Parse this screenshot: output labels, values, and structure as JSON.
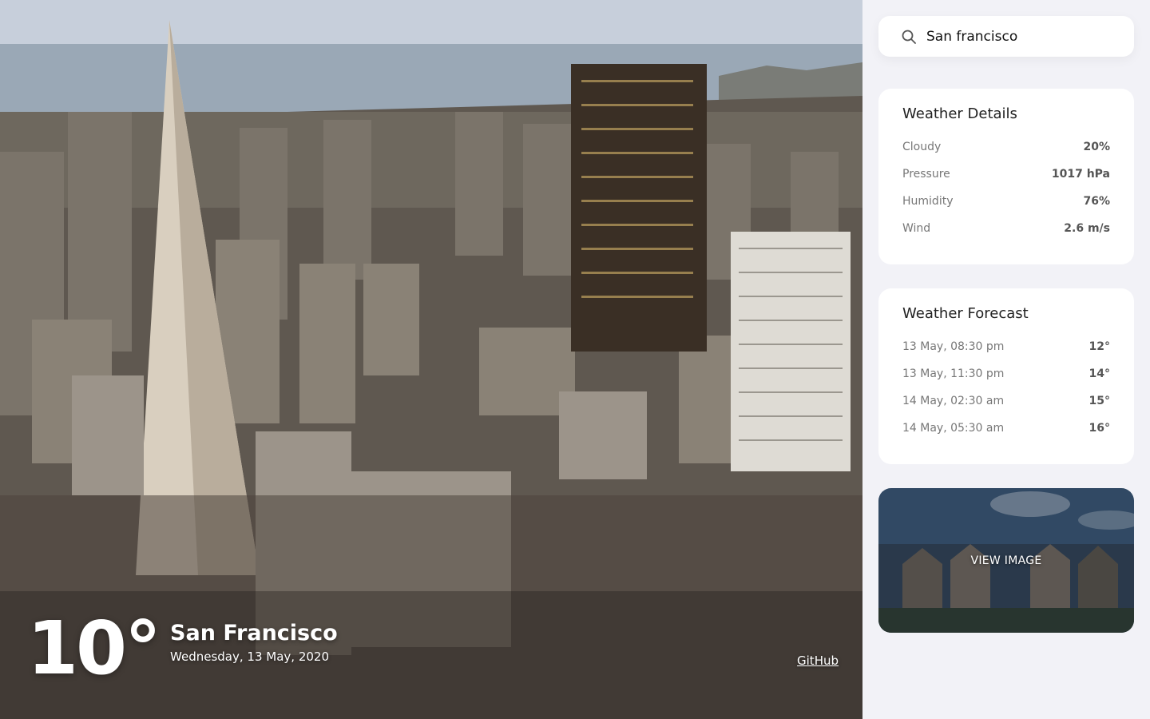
{
  "current": {
    "temperature": "10°",
    "city": "San Francisco",
    "date": "Wednesday, 13 May, 2020"
  },
  "links": {
    "github": "GitHub"
  },
  "search": {
    "value": "San francisco"
  },
  "details": {
    "title": "Weather Details",
    "rows": [
      {
        "label": "Cloudy",
        "value": "20%"
      },
      {
        "label": "Pressure",
        "value": "1017 hPa"
      },
      {
        "label": "Humidity",
        "value": "76%"
      },
      {
        "label": "Wind",
        "value": "2.6 m/s"
      }
    ]
  },
  "forecast": {
    "title": "Weather Forecast",
    "rows": [
      {
        "time": "13 May, 08:30 pm",
        "temp": "12°"
      },
      {
        "time": "13 May, 11:30 pm",
        "temp": "14°"
      },
      {
        "time": "14 May, 02:30 am",
        "temp": "15°"
      },
      {
        "time": "14 May, 05:30 am",
        "temp": "16°"
      }
    ]
  },
  "image_card": {
    "label": "VIEW IMAGE"
  },
  "colors": {
    "panel_bg": "#f2f2f7",
    "card_bg": "#ffffff",
    "label": "#777777",
    "value": "#555555"
  },
  "icons": {
    "search": "search-icon"
  }
}
